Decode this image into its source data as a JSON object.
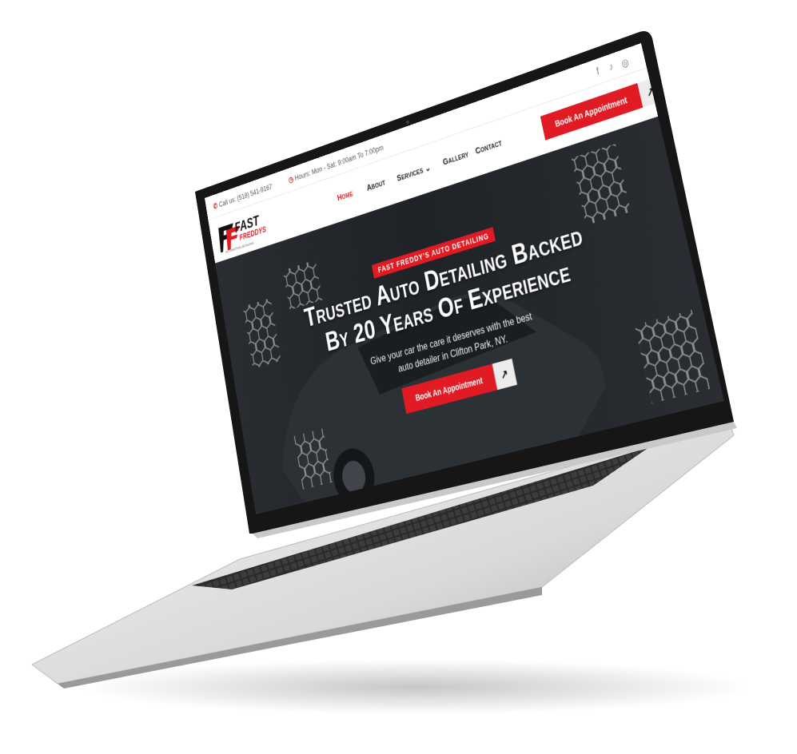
{
  "topbar": {
    "phone_label": "Call us: (518) 541-9167",
    "hours_label": "Hours: Mon - Sat: 9:00am To 7:00pm",
    "phone_icon": "phone-icon",
    "clock_icon": "clock-icon",
    "social": [
      {
        "name": "facebook-icon",
        "glyph": "f"
      },
      {
        "name": "tiktok-icon",
        "glyph": "♪"
      },
      {
        "name": "instagram-icon",
        "glyph": "◎"
      }
    ]
  },
  "header": {
    "logo_text_top": "FAST",
    "logo_text_bottom": "FREDDYS",
    "logo_tagline": "AUTOMOTIVE DETAILING",
    "nav": [
      "Home",
      "About",
      "Services",
      "Gallery",
      "Contact"
    ],
    "nav_active": "Home",
    "services_chevron": "chevron-down-icon",
    "book_label": "Book An Appointment",
    "arrow_glyph": "↗"
  },
  "hero": {
    "badge": "FAST FREDDY'S AUTO DETAILING",
    "title_line1": "Trusted Auto Detailing Backed",
    "title_line2": "By 20 Years Of Experience",
    "sub_line1": "Give your car the care it deserves with the best",
    "sub_line2": "auto detailer in Clifton Park, NY.",
    "book_label": "Book An Appointment",
    "arrow_glyph": "↗"
  },
  "colors": {
    "accent": "#e01b24",
    "hero_bg": "#2c3036",
    "text_light": "#ffffff"
  }
}
